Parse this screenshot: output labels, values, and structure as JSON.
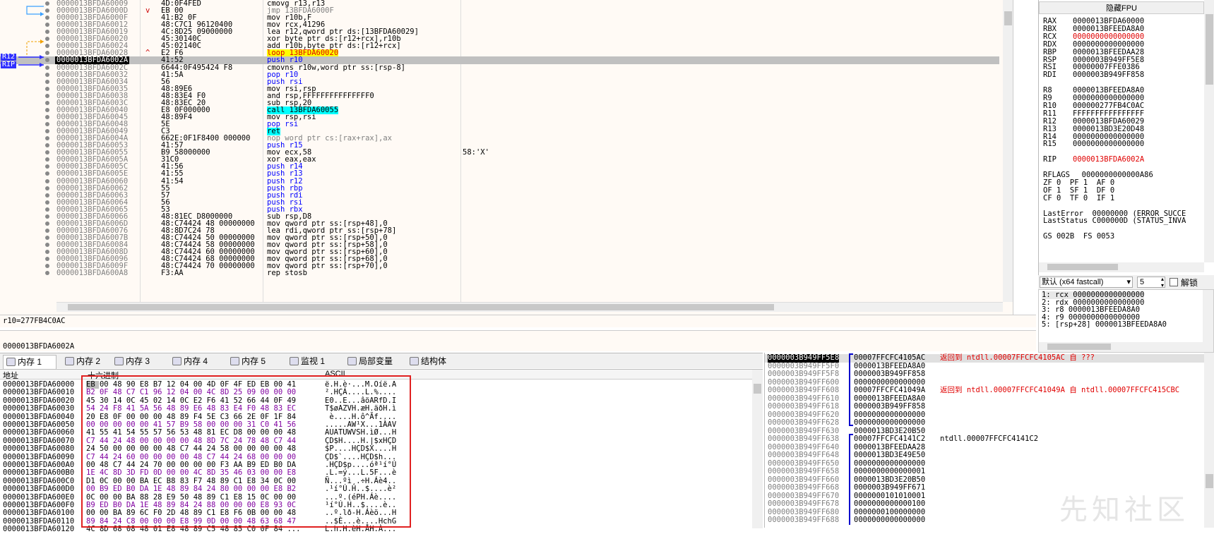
{
  "disasm": {
    "rows": [
      {
        "addr": "0000013BFDA60009",
        "mark": "",
        "bytes": "4D:0F4FED",
        "asm": "cmovg r13,r13",
        "cmt": ""
      },
      {
        "addr": "0000013BFDA6000D",
        "mark": "v",
        "bytes": "EB 00",
        "asm": "jmp 13BFDA6000F",
        "cmt": ""
      },
      {
        "addr": "0000013BFDA6000F",
        "mark": "",
        "bytes": "41:B2 0F",
        "asm": "mov r10b,F",
        "cmt": ""
      },
      {
        "addr": "0000013BFDA60012",
        "mark": "",
        "bytes": "48:C7C1 96120400",
        "asm": "mov rcx,41296",
        "cmt": ""
      },
      {
        "addr": "0000013BFDA60019",
        "mark": "",
        "bytes": "4C:8D25 09000000",
        "asm": "lea r12,qword ptr ds:[13BFDA60029]",
        "cmt": ""
      },
      {
        "addr": "0000013BFDA60020",
        "mark": "",
        "bytes": "45:30140C",
        "asm": "xor byte ptr ds:[r12+rcx],r10b",
        "cmt": ""
      },
      {
        "addr": "0000013BFDA60024",
        "mark": "",
        "bytes": "45:02140C",
        "asm": "add r10b,byte ptr ds:[r12+rcx]",
        "cmt": ""
      },
      {
        "addr": "0000013BFDA60028",
        "mark": "^",
        "bytes": "E2 F6",
        "asm": "loop 13BFDA60020",
        "cmt": ""
      },
      {
        "addr": "0000013BFDA6002A",
        "mark": "",
        "bytes": "41:52",
        "asm": "push r10",
        "cmt": "",
        "current": true
      },
      {
        "addr": "0000013BFDA6002C",
        "mark": "",
        "bytes": "6644:0F495424 F8",
        "asm": "cmovns r10w,word ptr ss:[rsp-8]",
        "cmt": ""
      },
      {
        "addr": "0000013BFDA60032",
        "mark": "",
        "bytes": "41:5A",
        "asm": "pop r10",
        "cmt": ""
      },
      {
        "addr": "0000013BFDA60034",
        "mark": "",
        "bytes": "56",
        "asm": "push rsi",
        "cmt": ""
      },
      {
        "addr": "0000013BFDA60035",
        "mark": "",
        "bytes": "48:89E6",
        "asm": "mov rsi,rsp",
        "cmt": ""
      },
      {
        "addr": "0000013BFDA60038",
        "mark": "",
        "bytes": "48:83E4 F0",
        "asm": "and rsp,FFFFFFFFFFFFFFF0",
        "cmt": ""
      },
      {
        "addr": "0000013BFDA6003C",
        "mark": "",
        "bytes": "48:83EC 20",
        "asm": "sub rsp,20",
        "cmt": ""
      },
      {
        "addr": "0000013BFDA60040",
        "mark": "",
        "bytes": "E8 0F000000",
        "asm": "call 13BFDA60055",
        "cmt": ""
      },
      {
        "addr": "0000013BFDA60045",
        "mark": "",
        "bytes": "48:89F4",
        "asm": "mov rsp,rsi",
        "cmt": ""
      },
      {
        "addr": "0000013BFDA60048",
        "mark": "",
        "bytes": "5E",
        "asm": "pop rsi",
        "cmt": ""
      },
      {
        "addr": "0000013BFDA60049",
        "mark": "",
        "bytes": "C3",
        "asm": "ret",
        "cmt": ""
      },
      {
        "addr": "0000013BFDA6004A",
        "mark": "",
        "bytes": "662E:0F1F8400 000000",
        "asm": "nop word ptr cs:[rax+rax],ax",
        "cmt": ""
      },
      {
        "addr": "0000013BFDA60053",
        "mark": "",
        "bytes": "41:57",
        "asm": "push r15",
        "cmt": ""
      },
      {
        "addr": "0000013BFDA60055",
        "mark": "",
        "bytes": "B9 58000000",
        "asm": "mov ecx,58",
        "cmt": "58:'X'"
      },
      {
        "addr": "0000013BFDA6005A",
        "mark": "",
        "bytes": "31C0",
        "asm": "xor eax,eax",
        "cmt": ""
      },
      {
        "addr": "0000013BFDA6005C",
        "mark": "",
        "bytes": "41:56",
        "asm": "push r14",
        "cmt": ""
      },
      {
        "addr": "0000013BFDA6005E",
        "mark": "",
        "bytes": "41:55",
        "asm": "push r13",
        "cmt": ""
      },
      {
        "addr": "0000013BFDA60060",
        "mark": "",
        "bytes": "41:54",
        "asm": "push r12",
        "cmt": ""
      },
      {
        "addr": "0000013BFDA60062",
        "mark": "",
        "bytes": "55",
        "asm": "push rbp",
        "cmt": ""
      },
      {
        "addr": "0000013BFDA60063",
        "mark": "",
        "bytes": "57",
        "asm": "push rdi",
        "cmt": ""
      },
      {
        "addr": "0000013BFDA60064",
        "mark": "",
        "bytes": "56",
        "asm": "push rsi",
        "cmt": ""
      },
      {
        "addr": "0000013BFDA60065",
        "mark": "",
        "bytes": "53",
        "asm": "push rbx",
        "cmt": ""
      },
      {
        "addr": "0000013BFDA60066",
        "mark": "",
        "bytes": "48:81EC D8000000",
        "asm": "sub rsp,D8",
        "cmt": ""
      },
      {
        "addr": "0000013BFDA6006D",
        "mark": "",
        "bytes": "48:C74424 48 00000000",
        "asm": "mov qword ptr ss:[rsp+48],0",
        "cmt": ""
      },
      {
        "addr": "0000013BFDA60076",
        "mark": "",
        "bytes": "48:8D7C24 78",
        "asm": "lea rdi,qword ptr ss:[rsp+78]",
        "cmt": ""
      },
      {
        "addr": "0000013BFDA6007B",
        "mark": "",
        "bytes": "48:C74424 50 00000000",
        "asm": "mov qword ptr ss:[rsp+50],0",
        "cmt": ""
      },
      {
        "addr": "0000013BFDA60084",
        "mark": "",
        "bytes": "48:C74424 58 00000000",
        "asm": "mov qword ptr ss:[rsp+58],0",
        "cmt": ""
      },
      {
        "addr": "0000013BFDA6008D",
        "mark": "",
        "bytes": "48:C74424 60 00000000",
        "asm": "mov qword ptr ss:[rsp+60],0",
        "cmt": ""
      },
      {
        "addr": "0000013BFDA60096",
        "mark": "",
        "bytes": "48:C74424 68 00000000",
        "asm": "mov qword ptr ss:[rsp+68],0",
        "cmt": ""
      },
      {
        "addr": "0000013BFDA6009F",
        "mark": "",
        "bytes": "48:C74424 70 00000000",
        "asm": "mov qword ptr ss:[rsp+70],0",
        "cmt": ""
      },
      {
        "addr": "0000013BFDA600A8",
        "mark": "",
        "bytes": "F3:AA",
        "asm": "rep stosb",
        "cmt": ""
      }
    ],
    "label_r12": "R12",
    "label_rip": "RIP"
  },
  "info": {
    "line1": "r10=277FB4C0AC",
    "line2": "0000013BFDA6002A"
  },
  "registers": {
    "title": "隐藏FPU",
    "rows": [
      {
        "n": "RAX",
        "v": "0000013BFDA60000",
        "c": "#000000"
      },
      {
        "n": "RBX",
        "v": "0000013BFEEDA8A0",
        "c": "#000000"
      },
      {
        "n": "RCX",
        "v": "0000000000000000",
        "c": "#e00000"
      },
      {
        "n": "RDX",
        "v": "0000000000000000",
        "c": "#000000"
      },
      {
        "n": "RBP",
        "v": "0000013BFEEDAA28",
        "c": "#000000"
      },
      {
        "n": "RSP",
        "v": "0000003B949FF5E8",
        "c": "#000000"
      },
      {
        "n": "RSI",
        "v": "00000007FFE0386",
        "c": "#000000"
      },
      {
        "n": "RDI",
        "v": "0000003B949FF858",
        "c": "#000000"
      },
      {
        "n": "",
        "v": "",
        "c": "#000000"
      },
      {
        "n": "R8",
        "v": "0000013BFEEDA8A0",
        "c": "#000000"
      },
      {
        "n": "R9",
        "v": "0000000000000000",
        "c": "#000000"
      },
      {
        "n": "R10",
        "v": "000000277FB4C0AC",
        "c": "#000000"
      },
      {
        "n": "R11",
        "v": "FFFFFFFFFFFFFFFF",
        "c": "#000000"
      },
      {
        "n": "R12",
        "v": "0000013BFDA60029",
        "c": "#000000"
      },
      {
        "n": "R13",
        "v": "0000013BD3E20D48",
        "c": "#000000"
      },
      {
        "n": "R14",
        "v": "0000000000000000",
        "c": "#000000"
      },
      {
        "n": "R15",
        "v": "0000000000000000",
        "c": "#000000"
      },
      {
        "n": "",
        "v": "",
        "c": "#000000"
      },
      {
        "n": "RIP",
        "v": "0000013BFDA6002A",
        "c": "#e00000"
      },
      {
        "n": "",
        "v": "",
        "c": "#000000"
      },
      {
        "n": "RFLAGS",
        "v": "  0000000000000A86",
        "c": "#000000"
      },
      {
        "n": "ZF 0  PF 1  AF 0",
        "v": "",
        "c": "#000000"
      },
      {
        "n": "OF 1  SF 1  DF 0",
        "v": "",
        "c": "#000000"
      },
      {
        "n": "CF 0  TF 0  IF 1",
        "v": "",
        "c": "#000000"
      },
      {
        "n": "",
        "v": "",
        "c": "#000000"
      },
      {
        "n": "LastError",
        "v": "  00000000 (ERROR_SUCCE",
        "c": "#000000"
      },
      {
        "n": "LastStatus",
        "v": " C000000D (STATUS_INVA",
        "c": "#000000"
      },
      {
        "n": "",
        "v": "",
        "c": "#000000"
      },
      {
        "n": "GS 002B  FS 0053",
        "v": "",
        "c": "#000000"
      }
    ],
    "call_conv": "默认 (x64 fastcall)",
    "arg_count": "5",
    "unlock_label": "解锁",
    "args": [
      "1: rcx 0000000000000000",
      "2: rdx 0000000000000000",
      "3: r8 0000013BFEEDA8A0",
      "4: r9 0000000000000000",
      "5: [rsp+28] 0000013BFEEDA8A0"
    ]
  },
  "tabs": [
    {
      "label": "内存 1",
      "active": true
    },
    {
      "label": "内存 2",
      "active": false
    },
    {
      "label": "内存 3",
      "active": false
    },
    {
      "label": "内存 4",
      "active": false
    },
    {
      "label": "内存 5",
      "active": false
    },
    {
      "label": "监视 1",
      "active": false
    },
    {
      "label": "局部变量",
      "active": false
    },
    {
      "label": "结构体",
      "active": false
    }
  ],
  "dump": {
    "col_addr": "地址",
    "col_hex": "十六进制",
    "col_ascii": "ASCII",
    "rows": [
      {
        "a": "0000013BFDA60000",
        "h": "EB 00 48 90 E8 B7 12 04 00 4D 0F 4F ED EB 00 41",
        "s": "ë.H.è·...M.Oíë.A"
      },
      {
        "a": "0000013BFDA60010",
        "h": "B2 0F 48 C7 C1 96 12 04 00 4C 8D 25 09 00 00 00",
        "s": "².HÇÁ....L.%...."
      },
      {
        "a": "0000013BFDA60020",
        "h": "45 30 14 0C 45 02 14 0C E2 F6 41 52 66 44 0F 49",
        "s": "E0..E...âöARfD.I"
      },
      {
        "a": "0000013BFDA60030",
        "h": "54 24 F8 41 5A 56 48 89 E6 48 83 E4 F0 48 83 EC",
        "s": "T$øAZVH.æH.äðH.ì"
      },
      {
        "a": "0000013BFDA60040",
        "h": "20 E8 0F 00 00 00 48 89 F4 5E C3 66 2E 0F 1F 84",
        "s": " è....H.ô^Ãf...."
      },
      {
        "a": "0000013BFDA60050",
        "h": "00 00 00 00 00 41 57 B9 58 00 00 00 31 C0 41 56",
        "s": ".....AW¹X...1ÀAV"
      },
      {
        "a": "0000013BFDA60060",
        "h": "41 55 41 54 55 57 56 53 48 81 EC D8 00 00 00 48",
        "s": "AUATUWVSH.ìØ...H"
      },
      {
        "a": "0000013BFDA60070",
        "h": "C7 44 24 48 00 00 00 00 48 8D 7C 24 78 48 C7 44",
        "s": "ÇD$H....H.|$xHÇD"
      },
      {
        "a": "0000013BFDA60080",
        "h": "24 50 00 00 00 00 48 C7 44 24 58 00 00 00 00 48",
        "s": "$P....HÇD$X....H"
      },
      {
        "a": "0000013BFDA60090",
        "h": "C7 44 24 60 00 00 00 00 48 C7 44 24 68 00 00 00",
        "s": "ÇD$`....HÇD$h..."
      },
      {
        "a": "0000013BFDA600A0",
        "h": "00 48 C7 44 24 70 00 00 00 00 F3 AA B9 ED B0 DA",
        "s": ".HÇD$p....óª¹í°Ú"
      },
      {
        "a": "0000013BFDA600B0",
        "h": "1E 4C 8D 3D FD 0D 00 00 4C 8D 35 46 03 00 00 E8",
        "s": ".L.=ý...L.5F...è"
      },
      {
        "a": "0000013BFDA600C0",
        "h": "D1 0C 00 00 BA EC B8 83 F7 48 89 C1 E8 34 0C 00",
        "s": "Ñ...ºì¸.÷H.Áè4.."
      },
      {
        "a": "0000013BFDA600D0",
        "h": "00 B9 ED B0 DA 1E 48 89 84 24 80 00 00 00 E8 B2",
        "s": ".¹í°Ú.H..$....è²"
      },
      {
        "a": "0000013BFDA600E0",
        "h": "0C 00 00 BA 88 28 E9 50 48 89 C1 E8 15 0C 00 00",
        "s": "...º.(éPH.Áè...."
      },
      {
        "a": "0000013BFDA600F0",
        "h": "B9 ED B0 DA 1E 48 89 84 24 88 00 00 00 E8 93 0C",
        "s": "¹í°Ú.H..$....è.."
      },
      {
        "a": "0000013BFDA60100",
        "h": "00 00 BA 89 6C F0 2D 48 89 C1 E8 F6 0B 00 00 48",
        "s": "..º.lð-H.Áèö...H"
      },
      {
        "a": "0000013BFDA60110",
        "h": "89 84 24 C8 00 00 00 E8 99 0D 00 00 48 63 68 47",
        "s": "..$È...è....HchG"
      },
      {
        "a": "0000013BFDA60120",
        "h": "4C 8D 68 08 48 01 E8 48 89 C5 48 85 C0 0F 84 ...",
        "s": "L.h.H.èH.ÅH.À..."
      }
    ]
  },
  "stack": {
    "rows": [
      {
        "a": "0000003B949FF5E8",
        "v": "00007FFCFC4105AC",
        "c": "返回到 ntdll.00007FFCFC4105AC 自 ???",
        "cc": "#e00000",
        "top": true
      },
      {
        "a": "0000003B949FF5F0",
        "v": "0000013BFEEDA8A0",
        "c": "",
        "cc": "#000000"
      },
      {
        "a": "0000003B949FF5F8",
        "v": "0000003B949FF858",
        "c": "",
        "cc": "#000000"
      },
      {
        "a": "0000003B949FF600",
        "v": "0000000000000000",
        "c": "",
        "cc": "#000000"
      },
      {
        "a": "0000003B949FF608",
        "v": "00007FFCFC41049A",
        "c": "返回到 ntdll.00007FFCFC41049A 自 ntdll.00007FFCFC415CBC",
        "cc": "#e00000"
      },
      {
        "a": "0000003B949FF610",
        "v": "0000013BFEEDA8A0",
        "c": "",
        "cc": "#000000"
      },
      {
        "a": "0000003B949FF618",
        "v": "0000003B949FF858",
        "c": "",
        "cc": "#000000"
      },
      {
        "a": "0000003B949FF620",
        "v": "0000000000000000",
        "c": "",
        "cc": "#000000"
      },
      {
        "a": "0000003B949FF628",
        "v": "0000000000000000",
        "c": "",
        "cc": "#000000"
      },
      {
        "a": "0000003B949FF630",
        "v": "0000013BD3E20B50",
        "c": "",
        "cc": "#000000"
      },
      {
        "a": "0000003B949FF638",
        "v": "00007FFCFC4141C2",
        "c": "ntdll.00007FFCFC4141C2",
        "cc": "#000000"
      },
      {
        "a": "0000003B949FF640",
        "v": "0000013BFEEDAA28",
        "c": "",
        "cc": "#000000"
      },
      {
        "a": "0000003B949FF648",
        "v": "0000013BD3E49E50",
        "c": "",
        "cc": "#000000"
      },
      {
        "a": "0000003B949FF650",
        "v": "0000000000000000",
        "c": "",
        "cc": "#000000"
      },
      {
        "a": "0000003B949FF658",
        "v": "0000000000000001",
        "c": "",
        "cc": "#000000"
      },
      {
        "a": "0000003B949FF660",
        "v": "0000013BD3E20B50",
        "c": "",
        "cc": "#000000"
      },
      {
        "a": "0000003B949FF668",
        "v": "0000003B949FF671",
        "c": "",
        "cc": "#000000"
      },
      {
        "a": "0000003B949FF670",
        "v": "0000000101010001",
        "c": "",
        "cc": "#000000"
      },
      {
        "a": "0000003B949FF678",
        "v": "0000000000000100",
        "c": "",
        "cc": "#000000"
      },
      {
        "a": "0000003B949FF680",
        "v": "0000000100000000",
        "c": "",
        "cc": "#000000"
      },
      {
        "a": "0000003B949FF688",
        "v": "0000000000000000",
        "c": "",
        "cc": "#000000"
      }
    ]
  },
  "watermark": "先知社区"
}
